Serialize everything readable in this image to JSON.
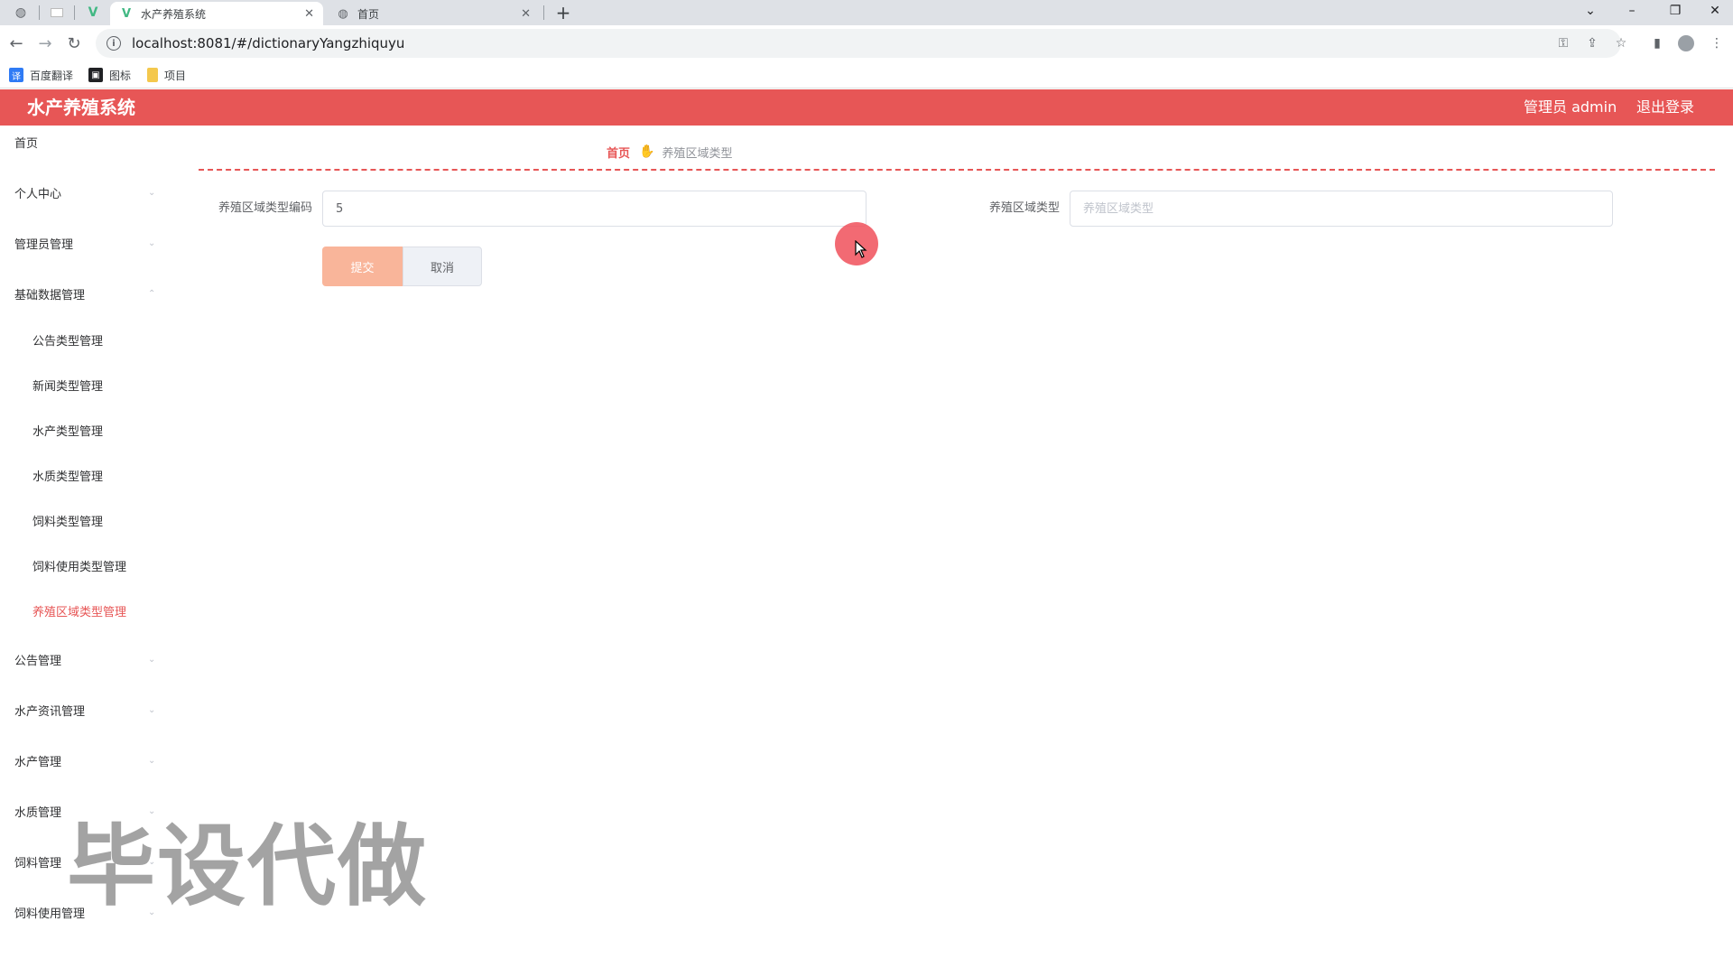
{
  "browser": {
    "tabs": [
      {
        "title": "水产养殖系统",
        "active": true
      },
      {
        "title": "首页",
        "active": false
      }
    ],
    "address": "localhost:8081/#/dictionaryYangzhiquyu",
    "bookmarks": [
      {
        "label": "百度翻译"
      },
      {
        "label": "图标"
      },
      {
        "label": "项目"
      }
    ]
  },
  "header": {
    "brand": "水产养殖系统",
    "user": "管理员 admin",
    "logout": "退出登录",
    "color": "#e75656"
  },
  "sidebar": {
    "items": [
      {
        "label": "首页"
      },
      {
        "label": "个人中心"
      },
      {
        "label": "管理员管理"
      },
      {
        "label": "基础数据管理"
      },
      {
        "label": "公告类型管理"
      },
      {
        "label": "新闻类型管理"
      },
      {
        "label": "水产类型管理"
      },
      {
        "label": "水质类型管理"
      },
      {
        "label": "饲料类型管理"
      },
      {
        "label": "饲料使用类型管理"
      },
      {
        "label": "养殖区域类型管理"
      },
      {
        "label": "公告管理"
      },
      {
        "label": "水产资讯管理"
      },
      {
        "label": "水产管理"
      },
      {
        "label": "水质管理"
      },
      {
        "label": "饲料管理"
      },
      {
        "label": "饲料使用管理"
      }
    ]
  },
  "breadcrumb": {
    "home": "首页",
    "current": "养殖区域类型"
  },
  "form": {
    "code_label": "养殖区域类型编码",
    "code_value": "5",
    "type_label": "养殖区域类型",
    "type_placeholder": "养殖区域类型",
    "submit_label": "提交",
    "cancel_label": "取消"
  },
  "watermark": "毕设代做"
}
